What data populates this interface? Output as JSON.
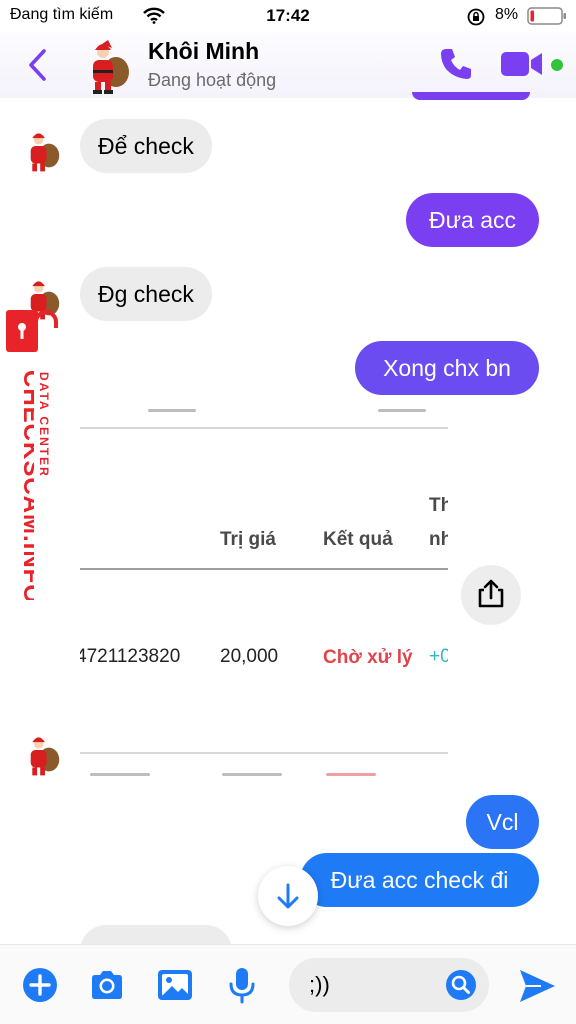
{
  "status_bar": {
    "carrier": "Đang tìm kiếm",
    "time": "17:42",
    "battery": "8%"
  },
  "header": {
    "contact_name": "Khôi Minh",
    "contact_status": "Đang hoạt động"
  },
  "messages": [
    {
      "side": "in",
      "text": "Để check"
    },
    {
      "side": "out",
      "text": "Đưa acc"
    },
    {
      "side": "in",
      "text": "Đg check"
    },
    {
      "side": "out",
      "text": "Xong chx bn"
    },
    {
      "side": "out",
      "text": "Vcl"
    },
    {
      "side": "out",
      "text": "Đưa acc check đi"
    }
  ],
  "shared_image": {
    "columns": [
      "Trị giá",
      "Kết quả",
      "Th",
      "nh"
    ],
    "row": {
      "code": "4721123820",
      "value": "20,000",
      "result": "Chờ xử lý",
      "extra": "+0"
    }
  },
  "composer": {
    "input_value": ";))"
  },
  "watermark": {
    "site": "CHECKSCAM.INFO",
    "subtitle": "DATA CENTER"
  },
  "colors": {
    "accent": "#7b3ff2",
    "outgoing_blue": "#1e7bf5",
    "incoming": "#ececec",
    "watermark_red": "#e8232a"
  }
}
